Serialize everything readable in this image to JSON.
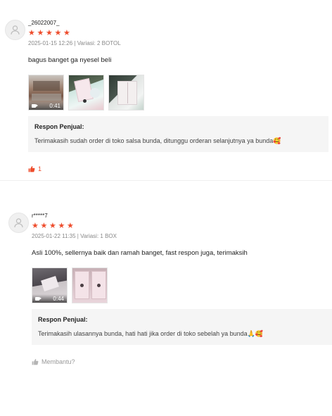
{
  "colors": {
    "accent": "#ee4d2d",
    "muted": "#888888",
    "panel": "#f5f5f5"
  },
  "reviews": [
    {
      "username": "_26022007_",
      "rating": 5,
      "meta": "2025-01-15 12:26 | Variasi: 2 BOTOL",
      "comment": "bagus banget ga nyesel beli",
      "media": [
        {
          "type": "video",
          "duration": "0:41",
          "icon": "video-camera-icon"
        },
        {
          "type": "image"
        },
        {
          "type": "image"
        }
      ],
      "seller_title": "Respon Penjual:",
      "seller_text": "Terimakasih sudah order di toko salsa bunda, ditunggu orderan selanjutnya ya bunda",
      "seller_emoji": "🥰",
      "like_count": "1"
    },
    {
      "username": "r*****7",
      "rating": 5,
      "meta": "2025-01-22 11:35 | Variasi: 1 BOX",
      "comment": "Asli 100%, sellernya baik dan ramah banget, fast respon juga, terimaksih",
      "media": [
        {
          "type": "video",
          "duration": "0:44",
          "icon": "video-camera-icon"
        },
        {
          "type": "image"
        }
      ],
      "seller_title": "Respon Penjual:",
      "seller_text": "Terimakasih ulasannya bunda, hati hati jika order di toko sebelah ya bunda",
      "seller_emoji": "🙏🥰",
      "helpful_label": "Membantu?"
    }
  ]
}
